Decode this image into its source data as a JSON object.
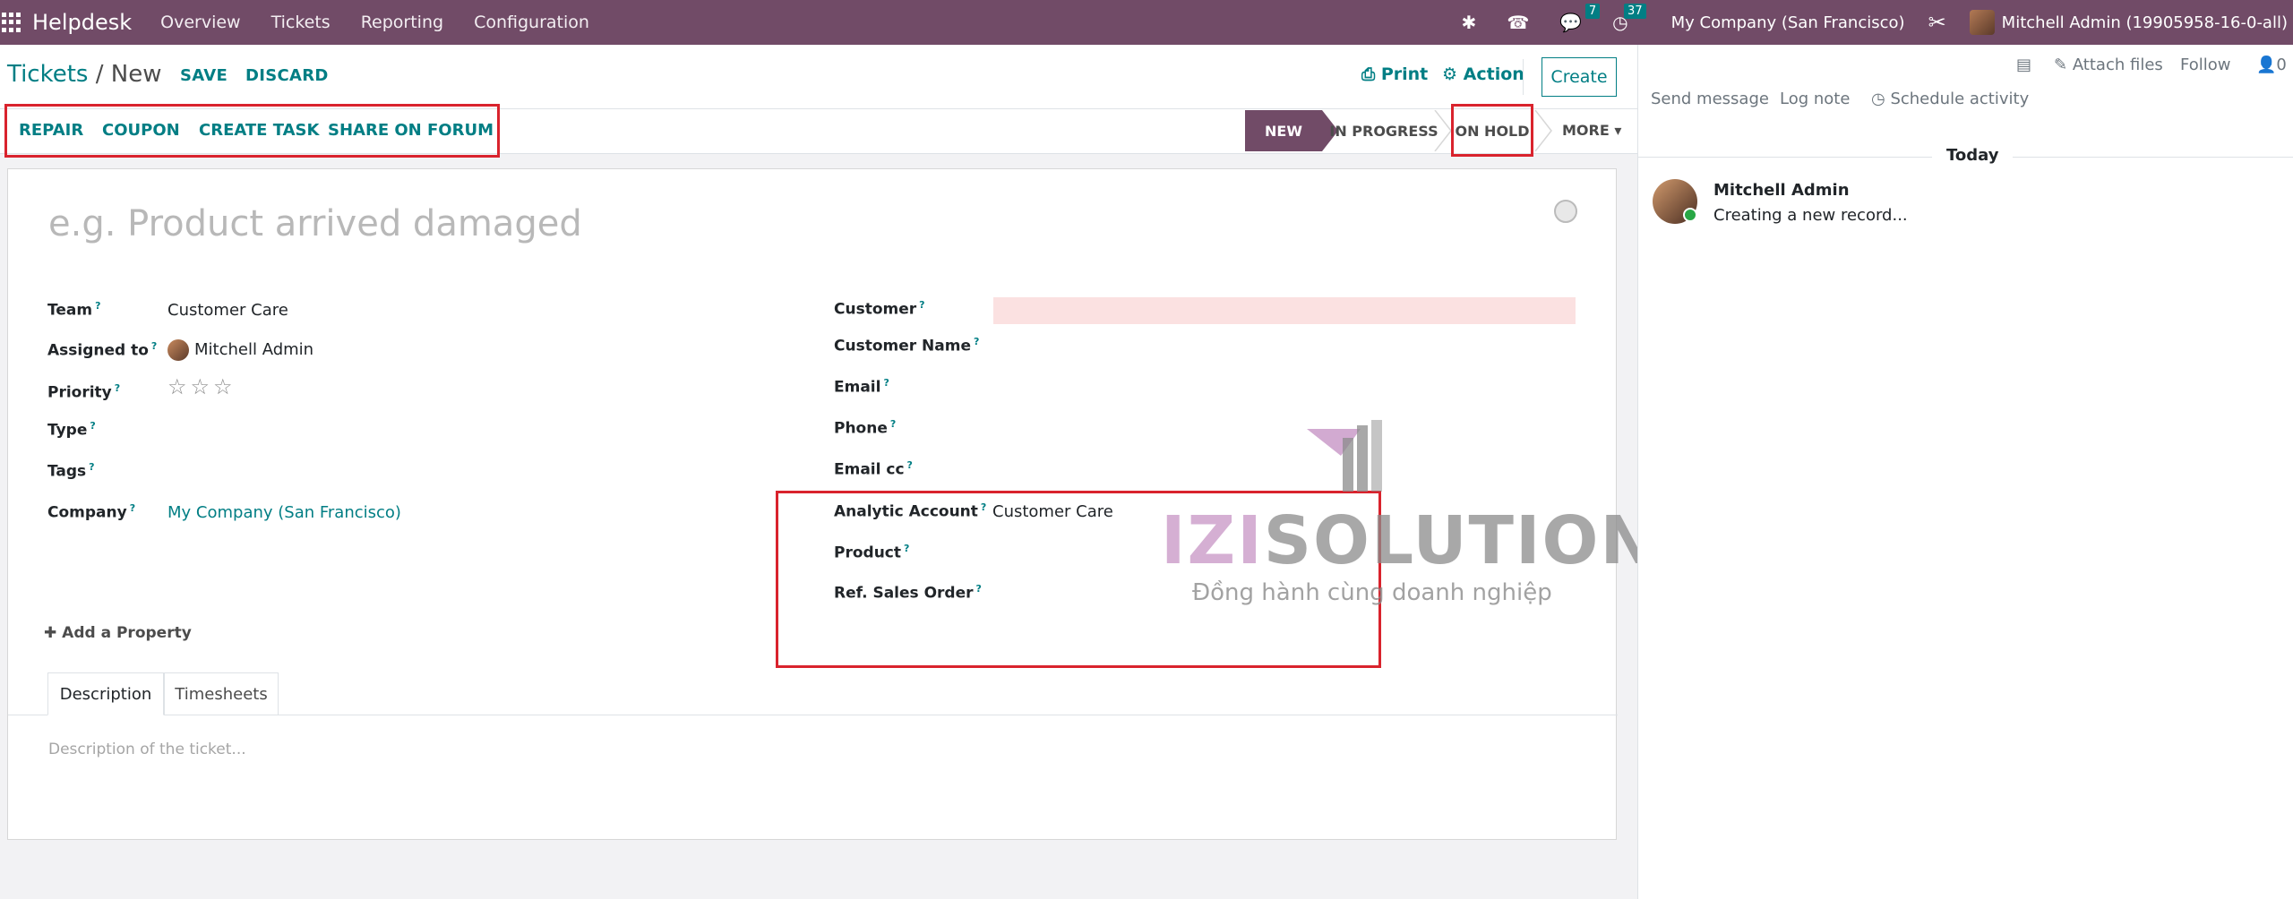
{
  "navbar": {
    "app_name": "Helpdesk",
    "menus": [
      "Overview",
      "Tickets",
      "Reporting",
      "Configuration"
    ],
    "messages_count": "7",
    "activities_count": "37",
    "company": "My Company (San Francisco)",
    "user": "Mitchell Admin (19905958-16-0-all)"
  },
  "control": {
    "breadcrumb_parent": "Tickets",
    "breadcrumb_sep": " / ",
    "breadcrumb_current": "New",
    "save": "SAVE",
    "discard": "DISCARD",
    "print": "Print",
    "action": "Action",
    "create": "Create"
  },
  "header_buttons": [
    "REPAIR",
    "COUPON",
    "CREATE TASK",
    "SHARE ON FORUM"
  ],
  "stages": [
    "NEW",
    "IN PROGRESS",
    "ON HOLD"
  ],
  "active_stage": "NEW",
  "more": "MORE",
  "form": {
    "title_placeholder": "e.g. Product arrived damaged",
    "left": {
      "team_label": "Team",
      "team_value": "Customer Care",
      "assigned_label": "Assigned to",
      "assigned_value": "Mitchell Admin",
      "priority_label": "Priority",
      "priority_stars": "☆☆☆",
      "type_label": "Type",
      "tags_label": "Tags",
      "company_label": "Company",
      "company_value": "My Company (San Francisco)"
    },
    "right": {
      "customer_label": "Customer",
      "customer_name_label": "Customer Name",
      "email_label": "Email",
      "phone_label": "Phone",
      "email_cc_label": "Email cc",
      "analytic_label": "Analytic Account",
      "analytic_value": "Customer Care",
      "product_label": "Product",
      "ref_so_label": "Ref. Sales Order"
    },
    "help_mark": "?",
    "add_property": "Add a Property",
    "tabs": [
      "Description",
      "Timesheets"
    ],
    "description_placeholder": "Description of the ticket..."
  },
  "watermark": {
    "brand_izi": "IZI",
    "brand_rest": "SOLUTION",
    "tagline": "Đồng hành cùng doanh nghiệp"
  },
  "chatter": {
    "attach": "Attach files",
    "follow": "Follow",
    "followers": "0",
    "send_message": "Send message",
    "log_note": "Log note",
    "schedule": "Schedule activity",
    "today": "Today",
    "author": "Mitchell Admin",
    "message": "Creating a new record..."
  },
  "colors": {
    "brand": "#714b67",
    "accent": "#017e84",
    "highlight_box": "#d9232d"
  }
}
